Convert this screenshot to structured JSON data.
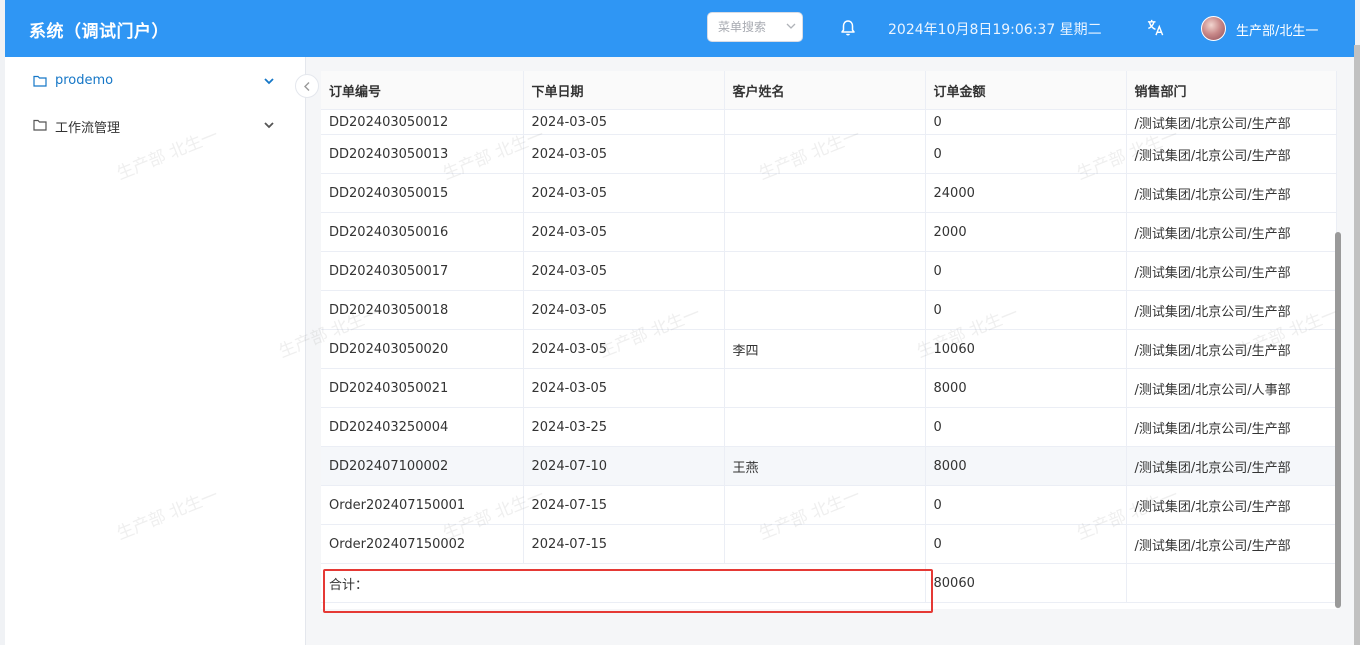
{
  "header": {
    "title": "系统（调试门户）",
    "search_placeholder": "菜单搜索",
    "datetime": "2024年10月8日19:06:37 星期二",
    "user": "生产部/北生一"
  },
  "sidebar": {
    "items": [
      {
        "label": "prodemo",
        "active": true
      },
      {
        "label": "工作流管理",
        "active": false
      }
    ]
  },
  "table": {
    "columns": [
      "订单编号",
      "下单日期",
      "客户姓名",
      "订单金额",
      "销售部门"
    ],
    "rows": [
      [
        "DD202403050012",
        "2024-03-05",
        "",
        "0",
        "/测试集团/北京公司/生产部"
      ],
      [
        "DD202403050013",
        "2024-03-05",
        "",
        "0",
        "/测试集团/北京公司/生产部"
      ],
      [
        "DD202403050015",
        "2024-03-05",
        "",
        "24000",
        "/测试集团/北京公司/生产部"
      ],
      [
        "DD202403050016",
        "2024-03-05",
        "",
        "2000",
        "/测试集团/北京公司/生产部"
      ],
      [
        "DD202403050017",
        "2024-03-05",
        "",
        "0",
        "/测试集团/北京公司/生产部"
      ],
      [
        "DD202403050018",
        "2024-03-05",
        "",
        "0",
        "/测试集团/北京公司/生产部"
      ],
      [
        "DD202403050020",
        "2024-03-05",
        "李四",
        "10060",
        "/测试集团/北京公司/生产部"
      ],
      [
        "DD202403050021",
        "2024-03-05",
        "",
        "8000",
        "/测试集团/北京公司/人事部"
      ],
      [
        "DD202403250004",
        "2024-03-25",
        "",
        "0",
        "/测试集团/北京公司/生产部"
      ],
      [
        "DD202407100002",
        "2024-07-10",
        "王燕",
        "8000",
        "/测试集团/北京公司/生产部"
      ],
      [
        "Order202407150001",
        "2024-07-15",
        "",
        "0",
        "/测试集团/北京公司/生产部"
      ],
      [
        "Order202407150002",
        "2024-07-15",
        "",
        "0",
        "/测试集团/北京公司/生产部"
      ]
    ],
    "summary_label": "合计：",
    "summary_amount": "80060"
  },
  "watermark": "生产部 北生一",
  "colors": {
    "header_bg": "#2f96f4",
    "active_menu": "#1677c7",
    "highlight_border": "#e53935"
  },
  "icons": {
    "folder": "folder-icon",
    "bell": "bell-icon",
    "translate": "translate-icon",
    "chevron": "chevron-down-icon",
    "collapse": "chevron-left-icon"
  }
}
